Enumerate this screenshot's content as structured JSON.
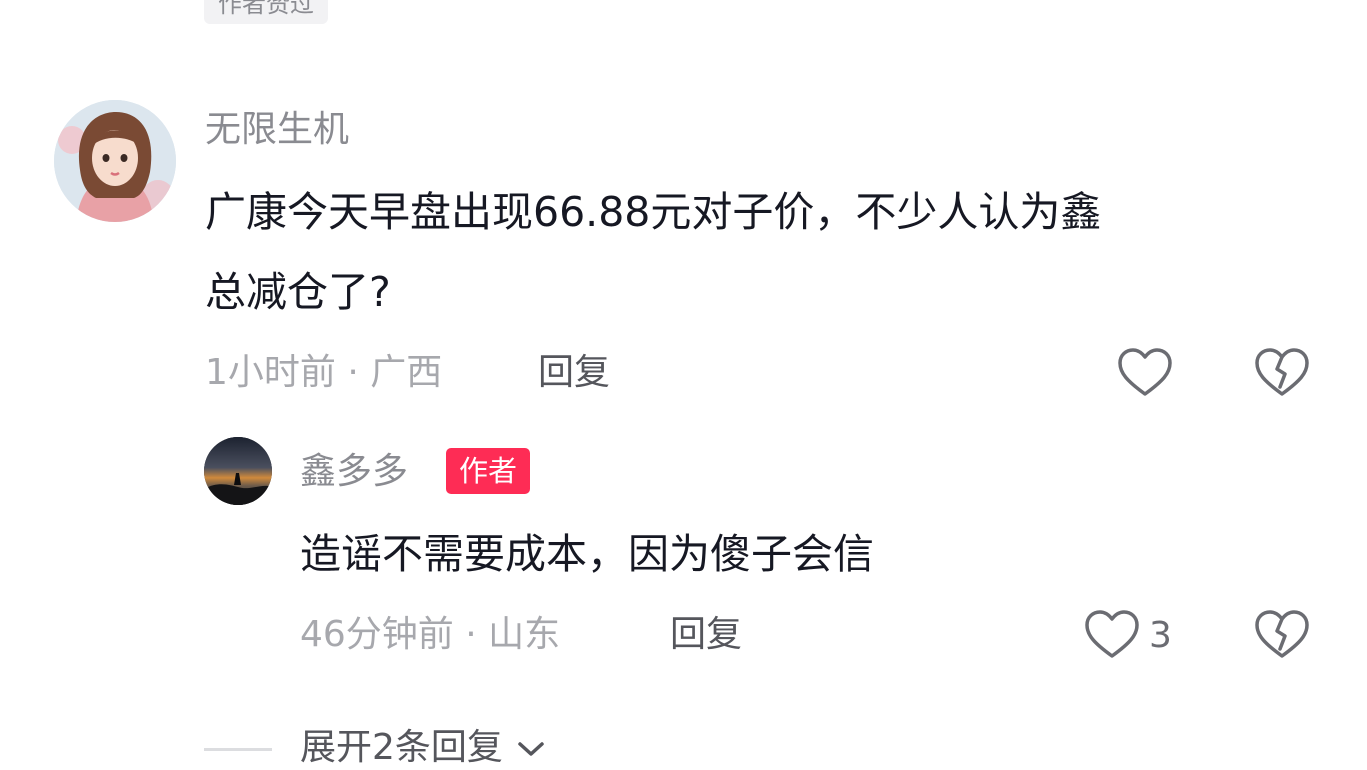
{
  "top_tag": "作者赞过",
  "comment": {
    "username": "无限生机",
    "text_line1": "广康今天早盘出现66.88元对子价，不少人认为鑫",
    "text_line2": "总减仓了?",
    "meta": "1小时前 · 广西",
    "reply_label": "回复"
  },
  "reply": {
    "username": "鑫多多",
    "badge": "作者",
    "text": "造谣不需要成本，因为傻子会信",
    "meta": "46分钟前 · 山东",
    "reply_label": "回复",
    "like_count": "3"
  },
  "expand_label": "展开2条回复",
  "colors": {
    "badge_red": "#fe2c55",
    "muted_text": "#a7a8ad",
    "username": "#8a8b91",
    "body_text": "#161823"
  }
}
